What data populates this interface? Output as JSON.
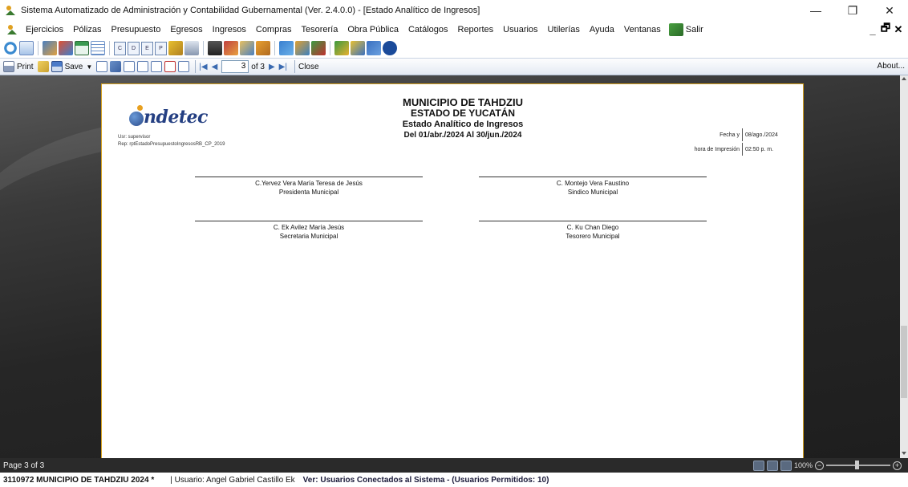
{
  "window": {
    "title": "Sistema Automatizado de Administración y Contabilidad Gubernamental  (Ver. 2.4.0.0) - [Estado Analítico de Ingresos]",
    "controls": [
      "—",
      "❐",
      "✕"
    ]
  },
  "menu": {
    "items": [
      "Ejercicios",
      "Pólizas",
      "Presupuesto",
      "Egresos",
      "Ingresos",
      "Compras",
      "Tesorería",
      "Obra Pública",
      "Catálogos",
      "Reportes",
      "Usuarios",
      "Utilerías",
      "Ayuda",
      "Ventanas"
    ],
    "salir": "Salir",
    "mdi_controls": [
      "_",
      "🗗",
      "✕"
    ]
  },
  "report_toolbar": {
    "print": "Print",
    "save": "Save",
    "page_value": "3",
    "page_of": "of 3",
    "close": "Close",
    "about": "About..."
  },
  "report": {
    "user_line": "Usr: supervisor",
    "rep_line": "Rep: rptEstadoPresupuestoIngresosRB_CP_2019",
    "municipio": "MUNICIPIO DE TAHDZIU",
    "estado": "ESTADO DE YUCATÁN",
    "report_title": "Estado Analítico de Ingresos",
    "period": "Del 01/abr./2024 Al 30/jun./2024",
    "fecha_label": "Fecha y",
    "fecha_value": "08/ago./2024",
    "hora_label": "hora de Impresión",
    "hora_value": "02:50 p. m.",
    "logo_text": "ndetec",
    "signatures": [
      {
        "name": "C.Yervez Vera María Teresa de Jesús",
        "role": "Presidenta Municipal"
      },
      {
        "name": "C. Montejo Vera Faustino",
        "role": "Sindico Municipal"
      },
      {
        "name": "C. Ek Avilez María Jesús",
        "role": "Secretaria Municipal"
      },
      {
        "name": "C. Ku Chan Diego",
        "role": "Tesorero Municipal"
      }
    ]
  },
  "status": {
    "page": "Page 3 of 3",
    "zoom": "100%"
  },
  "bottom": {
    "municipio": "3110972 MUNICIPIO DE TAHDZIU  2024  *",
    "usuario": "| Usuario: Angel Gabriel Castillo Ek",
    "version": "Ver: Usuarios Conectados al Sistema - (Usuarios Permitidos: 10)"
  }
}
